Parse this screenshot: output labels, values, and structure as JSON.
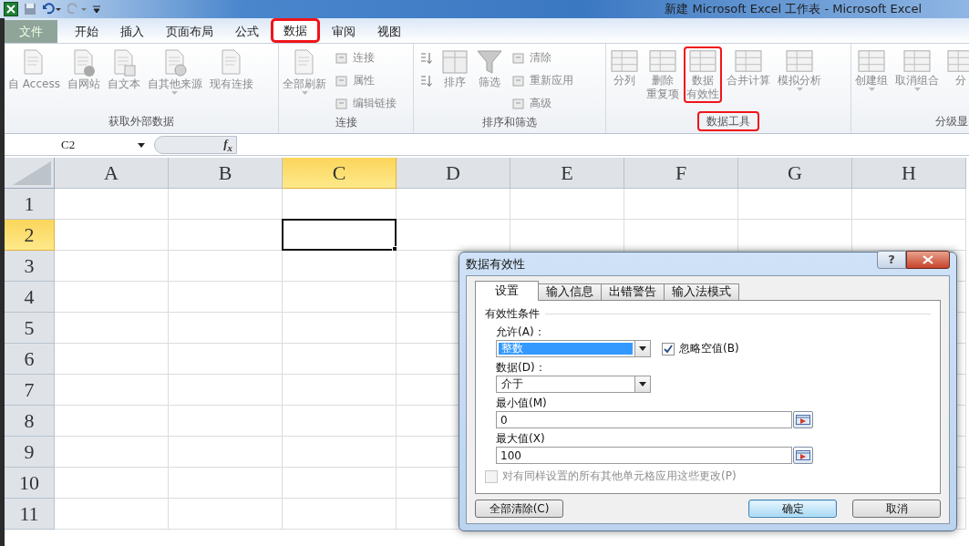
{
  "window": {
    "title": "新建 Microsoft Excel 工作表 - Microsoft Excel"
  },
  "ribbon_tabs": [
    {
      "label": "文件",
      "kind": "file",
      "selected": false,
      "highlighted": false
    },
    {
      "label": "开始",
      "kind": "tab",
      "selected": false,
      "highlighted": false
    },
    {
      "label": "插入",
      "kind": "tab",
      "selected": false,
      "highlighted": false
    },
    {
      "label": "页面布局",
      "kind": "tab",
      "selected": false,
      "highlighted": false
    },
    {
      "label": "公式",
      "kind": "tab",
      "selected": false,
      "highlighted": false
    },
    {
      "label": "数据",
      "kind": "tab",
      "selected": true,
      "highlighted": true
    },
    {
      "label": "审阅",
      "kind": "tab",
      "selected": false,
      "highlighted": false
    },
    {
      "label": "视图",
      "kind": "tab",
      "selected": false,
      "highlighted": false
    }
  ],
  "ribbon_groups": [
    {
      "label": "获取外部数据",
      "highlighted": false,
      "items": [
        {
          "label": [
            "自 Access"
          ],
          "kind": "large",
          "dropdown": false,
          "highlighted": false
        },
        {
          "label": [
            "自网站"
          ],
          "kind": "large",
          "dropdown": false,
          "highlighted": false
        },
        {
          "label": [
            "自文本"
          ],
          "kind": "large",
          "dropdown": false,
          "highlighted": false
        },
        {
          "label": [
            "自其他来源"
          ],
          "kind": "large",
          "dropdown": true,
          "highlighted": false
        },
        {
          "label": [
            "现有连接"
          ],
          "kind": "large",
          "dropdown": false,
          "highlighted": false
        }
      ]
    },
    {
      "label": "连接",
      "highlighted": false,
      "items": [
        {
          "label": [
            "全部刷新"
          ],
          "kind": "large",
          "dropdown": true,
          "highlighted": false
        },
        {
          "label": [
            "连接"
          ],
          "kind": "small",
          "highlighted": false
        },
        {
          "label": [
            "属性"
          ],
          "kind": "small",
          "highlighted": false
        },
        {
          "label": [
            "编辑链接"
          ],
          "kind": "small",
          "highlighted": false
        }
      ]
    },
    {
      "label": "排序和筛选",
      "highlighted": false,
      "items": [
        {
          "kind": "small",
          "highlighted": false
        },
        {
          "kind": "small",
          "highlighted": false
        },
        {
          "label": [
            "排序"
          ],
          "kind": "large",
          "dropdown": false,
          "highlighted": false
        },
        {
          "label": [
            "筛选"
          ],
          "kind": "large",
          "dropdown": false,
          "highlighted": false
        },
        {
          "label": [
            "清除"
          ],
          "kind": "small",
          "highlighted": false
        },
        {
          "label": [
            "重新应用"
          ],
          "kind": "small",
          "highlighted": false
        },
        {
          "label": [
            "高级"
          ],
          "kind": "small",
          "highlighted": false
        }
      ]
    },
    {
      "label": "数据工具",
      "highlighted": true,
      "items": [
        {
          "label": [
            "分列"
          ],
          "kind": "large",
          "dropdown": false,
          "highlighted": false
        },
        {
          "label": [
            "删除",
            "重复项"
          ],
          "kind": "large",
          "dropdown": false,
          "highlighted": false
        },
        {
          "label": [
            "数据",
            "有效性"
          ],
          "kind": "large",
          "dropdown": false,
          "highlighted": true
        },
        {
          "label": [
            "合并计算"
          ],
          "kind": "large",
          "dropdown": false,
          "highlighted": false
        },
        {
          "label": [
            "模拟分析"
          ],
          "kind": "large",
          "dropdown": true,
          "highlighted": false
        }
      ]
    },
    {
      "label": "分级显",
      "highlighted": false,
      "items": [
        {
          "label": [
            "创建组"
          ],
          "kind": "large",
          "dropdown": true,
          "highlighted": false
        },
        {
          "label": [
            "取消组合"
          ],
          "kind": "large",
          "dropdown": true,
          "highlighted": false
        },
        {
          "label": [
            "分"
          ],
          "kind": "large",
          "dropdown": false,
          "highlighted": false
        }
      ]
    }
  ],
  "formula_bar": {
    "name_box": "C2",
    "function_button": "f$_{x}$"
  },
  "sheet": {
    "columns": [
      {
        "label": "A",
        "selected": false
      },
      {
        "label": "B",
        "selected": false
      },
      {
        "label": "C",
        "selected": true
      },
      {
        "label": "D",
        "selected": false
      },
      {
        "label": "E",
        "selected": false
      },
      {
        "label": "F",
        "selected": false
      },
      {
        "label": "G",
        "selected": false
      },
      {
        "label": "H",
        "selected": false
      }
    ],
    "rows": [
      {
        "label": "1",
        "selected": false
      },
      {
        "label": "2",
        "selected": true
      },
      {
        "label": "3",
        "selected": false
      },
      {
        "label": "4",
        "selected": false
      },
      {
        "label": "5",
        "selected": false
      },
      {
        "label": "6",
        "selected": false
      },
      {
        "label": "7",
        "selected": false
      },
      {
        "label": "8",
        "selected": false
      },
      {
        "label": "9",
        "selected": false
      },
      {
        "label": "10",
        "selected": false
      },
      {
        "label": "11",
        "selected": false
      }
    ]
  },
  "dialog": {
    "title": "数据有效性",
    "help_button": "?",
    "tabs": [
      {
        "label": "设置",
        "selected": true
      },
      {
        "label": "输入信息",
        "selected": false
      },
      {
        "label": "出错警告",
        "selected": false
      },
      {
        "label": "输入法模式",
        "selected": false
      }
    ],
    "section_title": "有效性条件",
    "fields": [
      {
        "kind": "select",
        "label": "允许(A)：",
        "value": "整数",
        "highlighted": true,
        "checkbox": {
          "label": "忽略空值(B)",
          "checked": true
        }
      },
      {
        "kind": "select",
        "label": "数据(D)：",
        "value": "介于",
        "highlighted": false
      },
      {
        "kind": "range",
        "label": "最小值(M)",
        "value": "0"
      },
      {
        "kind": "range",
        "label": "最大值(X)",
        "value": "100"
      }
    ],
    "apply_all": {
      "label": "对有同样设置的所有其他单元格应用这些更改(P)",
      "checked": false,
      "disabled": true
    },
    "buttons": [
      {
        "label": "全部清除(C)",
        "default": false
      },
      {
        "label": "确定",
        "default": true
      },
      {
        "label": "取消",
        "default": false
      }
    ]
  }
}
